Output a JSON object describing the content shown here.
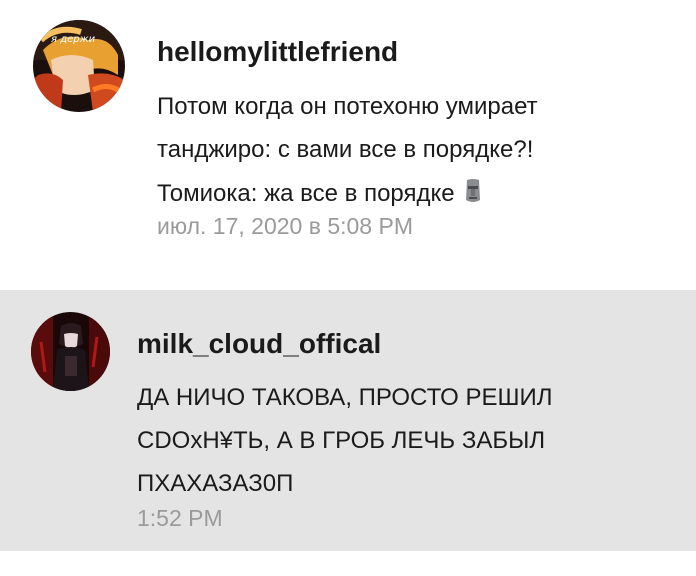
{
  "comments": [
    {
      "username": "hellomylittlefriend",
      "avatar_icon": "anime-avatar-icon",
      "avatar_text": "я держи",
      "lines": [
        "Потом когда он потехоню умирает",
        "танджиро: с вами все в порядке?!",
        "Томиока: жа все в порядке"
      ],
      "trailing_emoji": "moai-emoji-icon",
      "timestamp": "июл. 17, 2020 в 5:08 PM"
    },
    {
      "username": "milk_cloud_offical",
      "avatar_icon": "anime-avatar-icon",
      "lines": [
        "ДА НИЧО ТАКОВА, ПРОСТО РЕШИЛ",
        "CDOxH¥ТЬ, А В ГРОБ ЛЕЧЬ ЗАБЫЛ",
        "ПХАХАЗАЗ0П"
      ],
      "timestamp": "1:52 PM"
    }
  ],
  "colors": {
    "second_comment_background": "#e4e4e4",
    "timestamp": "#9a9a9a",
    "text": "#1b1b1b"
  }
}
